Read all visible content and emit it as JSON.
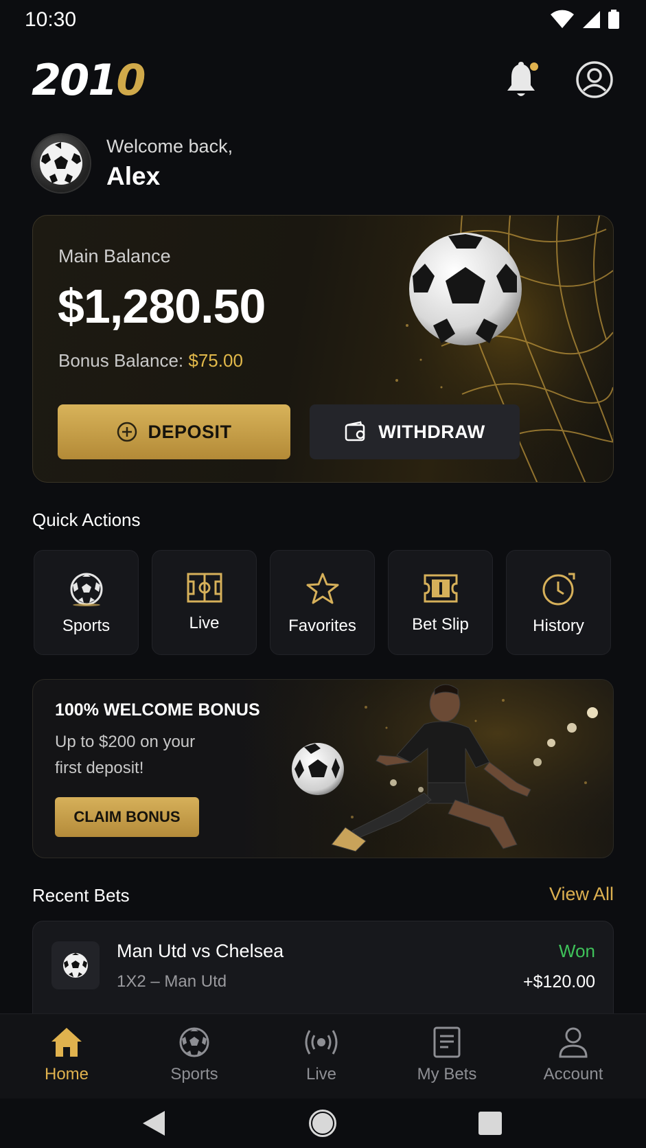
{
  "status_bar": {
    "time": "10:30"
  },
  "header": {
    "logo_white": "201",
    "logo_gold": "0"
  },
  "welcome": {
    "greeting": "Welcome back,",
    "name": "Alex"
  },
  "balance": {
    "label": "Main Balance",
    "amount": "$1,280.50",
    "bonus_label": "Bonus Balance:",
    "bonus_value": "$75.00",
    "deposit_label": "DEPOSIT",
    "withdraw_label": "WITHDRAW"
  },
  "quick_actions": {
    "title": "Quick Actions",
    "items": [
      {
        "label": "Sports",
        "icon": "soccer-ball-icon"
      },
      {
        "label": "Live",
        "icon": "pitch-icon"
      },
      {
        "label": "Favorites",
        "icon": "star-icon"
      },
      {
        "label": "Bet Slip",
        "icon": "ticket-icon"
      },
      {
        "label": "History",
        "icon": "clock-icon"
      }
    ]
  },
  "promo": {
    "title": "100% WELCOME BONUS",
    "subtitle": "Up to $200 on your first deposit!",
    "cta": "CLAIM BONUS"
  },
  "recent_bets": {
    "title": "Recent Bets",
    "view_all": "View All",
    "items": [
      {
        "match": "Man Utd vs Chelsea",
        "market": "1X2 – Man Utd",
        "status": "Won",
        "amount": "+$120.00"
      }
    ]
  },
  "bottom_nav": {
    "items": [
      {
        "label": "Home",
        "icon": "home-icon",
        "active": true
      },
      {
        "label": "Sports",
        "icon": "soccer-ball-icon",
        "active": false
      },
      {
        "label": "Live",
        "icon": "broadcast-icon",
        "active": false
      },
      {
        "label": "My Bets",
        "icon": "document-icon",
        "active": false
      },
      {
        "label": "Account",
        "icon": "person-icon",
        "active": false
      }
    ]
  },
  "colors": {
    "accent_gold": "#d6b05a",
    "background": "#0c0d10",
    "won_green": "#3fc25a"
  }
}
